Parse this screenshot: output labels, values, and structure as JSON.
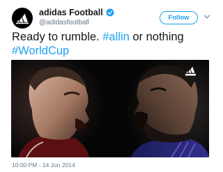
{
  "account": {
    "name": "adidas Football",
    "handle": "@adidasfootball",
    "verified": true,
    "avatar_icon": "adidas-logo-icon"
  },
  "follow_button": {
    "label": "Follow"
  },
  "tweet": {
    "text_plain": "Ready to rumble. ",
    "hashtag1": "#allin",
    "text_middle": " or nothing",
    "hashtag2": "#WorldCup",
    "timestamp": "10:00 PM - 14 Jun 2014"
  },
  "media": {
    "description_icon": "photo-two-players-facing-off",
    "watermark_icon": "adidas-logo-icon"
  },
  "colors": {
    "link": "#1da1f2",
    "text": "#14171a",
    "muted": "#657786",
    "background": "#ffffff"
  }
}
